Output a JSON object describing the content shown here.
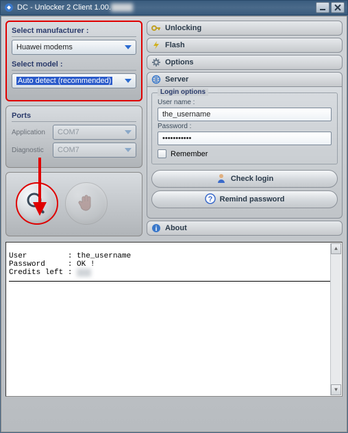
{
  "window": {
    "title": "DC - Unlocker 2 Client 1.00."
  },
  "left": {
    "manufacturer_label": "Select manufacturer :",
    "manufacturer_value": "Huawei modems",
    "model_label": "Select model :",
    "model_value": "Auto detect (recommended)",
    "ports_label": "Ports",
    "application_label": "Application",
    "application_value": "COM7",
    "diagnostic_label": "Diagnostic",
    "diagnostic_value": "COM7"
  },
  "accordion": {
    "unlocking": "Unlocking",
    "flash": "Flash",
    "options": "Options",
    "server": "Server",
    "about": "About"
  },
  "server": {
    "login_options": "Login options",
    "username_label": "User name :",
    "username_value": "the_username",
    "password_label": "Password :",
    "password_value": "xxxxxxxxxxx",
    "remember": "Remember",
    "check_login": "Check login",
    "remind_password": "Remind password"
  },
  "log": {
    "line1": "User         : the_username",
    "line2": "Password     : OK !",
    "line3": "Credits left : "
  }
}
